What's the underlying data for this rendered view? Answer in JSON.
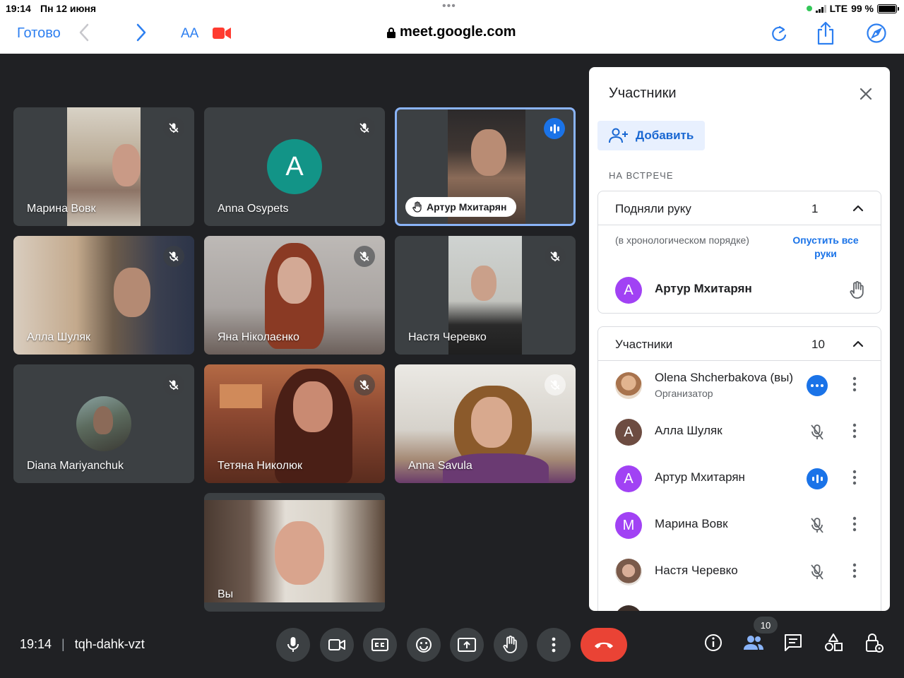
{
  "status_bar": {
    "time": "19:14",
    "date": "Пн 12 июня",
    "network": "LTE",
    "battery": "99 %",
    "battery_level": 0.99
  },
  "browser": {
    "done_label": "Готово",
    "text_size_label": "AA",
    "url": "meet.google.com"
  },
  "tiles": [
    {
      "name": "Марина Вовк",
      "muted": true
    },
    {
      "name": "Anna Osypets",
      "muted": true,
      "avatar_letter": "A",
      "avatar_color": "#129487"
    },
    {
      "name": "Артур Мхитарян",
      "speaking": true,
      "hand_raised": true
    },
    {
      "name": "Алла Шуляк",
      "muted": true
    },
    {
      "name": "Яна Ніколаєнко",
      "muted": true
    },
    {
      "name": "Настя Черевко",
      "muted": true
    },
    {
      "name": "Diana Mariyanchuk",
      "muted": true
    },
    {
      "name": "Тетяна Николюк",
      "muted": true
    },
    {
      "name": "Anna Savula",
      "muted": true
    },
    {
      "name": "Вы"
    }
  ],
  "panel": {
    "title": "Участники",
    "add_label": "Добавить",
    "section_label": "НА ВСТРЕЧЕ",
    "raised_hands": {
      "label": "Подняли руку",
      "count": "1",
      "hint": "(в хронологическом порядке)",
      "lower_all": "Опустить все руки",
      "people": [
        {
          "name": "Артур Мхитарян",
          "letter": "A",
          "color": "#a142f4"
        }
      ]
    },
    "participants": {
      "label": "Участники",
      "count": "10",
      "people": [
        {
          "name": "Olena Shcherbakova (вы)",
          "role": "Организатор",
          "status": "more-icon"
        },
        {
          "name": "Алла Шуляк",
          "letter": "A",
          "color": "#6d4c41",
          "status": "mic-off-icon"
        },
        {
          "name": "Артур Мхитарян",
          "letter": "A",
          "color": "#a142f4",
          "status": "speaking-icon"
        },
        {
          "name": "Марина Вовк",
          "letter": "M",
          "color": "#a142f4",
          "status": "mic-off-icon"
        },
        {
          "name": "Настя Черевко",
          "status": "mic-off-icon"
        }
      ]
    }
  },
  "bottom_bar": {
    "time": "19:14",
    "meeting_code": "tqh-dahk-vzt",
    "participants_badge": "10"
  },
  "colors": {
    "meet_background": "#202124",
    "tile_background": "#3c4043",
    "accent_blue": "#1a73e8",
    "end_call_red": "#ea4335",
    "safari_blue": "#2d7ff0"
  }
}
